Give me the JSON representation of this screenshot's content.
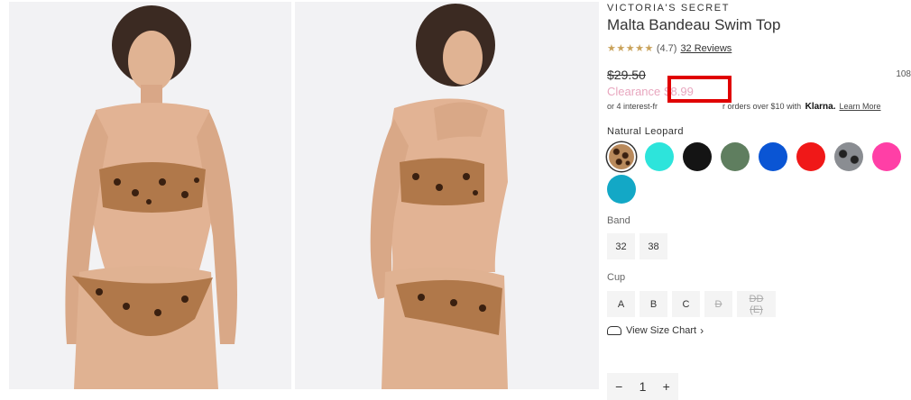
{
  "product": {
    "brand": "VICTORIA'S SECRET",
    "title": "Malta Bandeau Swim Top",
    "rating_stars": "★★★★★",
    "rating_value": "(4.7)",
    "reviews_link": "32 Reviews",
    "original_price": "$29.50",
    "item_number": "108",
    "clearance_label": "Clearance",
    "clearance_price": "$8.99",
    "installments_text": "or 4 interest-fr",
    "installments_text_cont": "r orders over $10 with",
    "klarna_brand": "Klarna.",
    "learn_more": "Learn More"
  },
  "colors": {
    "selected_name": "Natural Leopard",
    "swatches": [
      {
        "name": "swatch-natural-leopard",
        "color": "#b98a5c",
        "pattern": "leopard",
        "selected": true
      },
      {
        "name": "swatch-aqua",
        "color": "#2de4db"
      },
      {
        "name": "swatch-black",
        "color": "#141414"
      },
      {
        "name": "swatch-green",
        "color": "#5f7e5f"
      },
      {
        "name": "swatch-blue",
        "color": "#0a55d4"
      },
      {
        "name": "swatch-red",
        "color": "#f01818"
      },
      {
        "name": "swatch-snake",
        "color": "#8a8d92",
        "pattern": "snake"
      },
      {
        "name": "swatch-pink",
        "color": "#ff3fa6"
      },
      {
        "name": "swatch-teal",
        "color": "#13a8c6"
      }
    ]
  },
  "band": {
    "label": "Band",
    "options": [
      {
        "label": "32",
        "available": true
      },
      {
        "label": "38",
        "available": true
      }
    ]
  },
  "cup": {
    "label": "Cup",
    "options": [
      {
        "label": "A",
        "available": true
      },
      {
        "label": "B",
        "available": true
      },
      {
        "label": "C",
        "available": true
      },
      {
        "label": "D",
        "available": false
      },
      {
        "label": "DD (E)",
        "available": false
      }
    ]
  },
  "size_chart": {
    "label": "View Size Chart",
    "chevron": "›"
  },
  "quantity": {
    "minus": "−",
    "value": "1",
    "plus": "+"
  },
  "accent": {
    "highlight_box": "#e00000",
    "clearance": "#e8a7bf",
    "stars": "#c9a25a"
  }
}
